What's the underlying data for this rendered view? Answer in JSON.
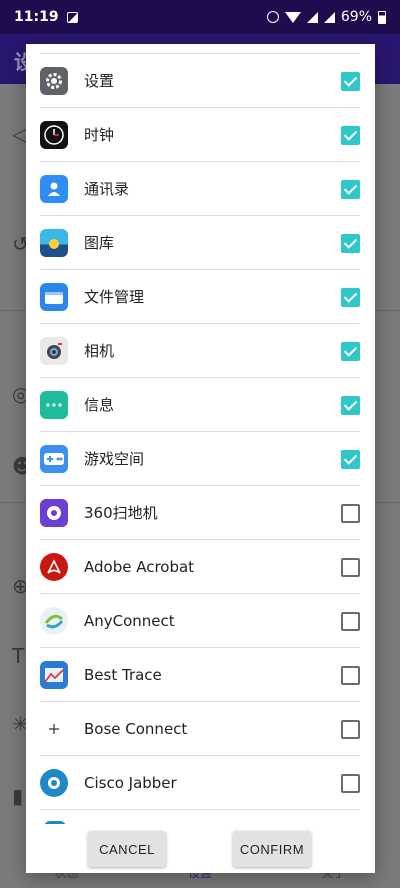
{
  "status_bar": {
    "time": "11:19",
    "battery": "69%"
  },
  "app_bar": {
    "title_fragment": "设"
  },
  "background_nav": {
    "items": [
      "状态",
      "设置",
      "关于"
    ]
  },
  "dialog": {
    "apps": [
      {
        "label": "设置",
        "icon": "settings-gear-icon",
        "checked": true,
        "color": "#5f6368"
      },
      {
        "label": "时钟",
        "icon": "clock-icon",
        "checked": true,
        "color": "#111111"
      },
      {
        "label": "通讯录",
        "icon": "contacts-icon",
        "checked": true,
        "color": "#2f8ef3"
      },
      {
        "label": "图库",
        "icon": "gallery-icon",
        "checked": true,
        "color": "#1d4f8c"
      },
      {
        "label": "文件管理",
        "icon": "file-manager-icon",
        "checked": true,
        "color": "#2a86e8"
      },
      {
        "label": "相机",
        "icon": "camera-icon",
        "checked": true,
        "color": "#e9e9e9"
      },
      {
        "label": "信息",
        "icon": "messages-icon",
        "checked": true,
        "color": "#1fbc9c"
      },
      {
        "label": "游戏空间",
        "icon": "game-space-icon",
        "checked": true,
        "color": "#3d8ff0"
      },
      {
        "label": "360扫地机",
        "icon": "robot-vacuum-icon",
        "checked": false,
        "color": "#6a3fd1"
      },
      {
        "label": "Adobe Acrobat",
        "icon": "adobe-acrobat-icon",
        "checked": false,
        "color": "#c8180f"
      },
      {
        "label": "AnyConnect",
        "icon": "anyconnect-icon",
        "checked": false,
        "color": "#3aa0c8"
      },
      {
        "label": "Best Trace",
        "icon": "best-trace-icon",
        "checked": false,
        "color": "#2a7bd6"
      },
      {
        "label": "Bose Connect",
        "icon": "bose-connect-icon",
        "checked": false,
        "color": "#333333"
      },
      {
        "label": "Cisco Jabber",
        "icon": "cisco-jabber-icon",
        "checked": false,
        "color": "#1e88c9"
      }
    ],
    "cancel_label": "CANCEL",
    "confirm_label": "CONFIRM"
  }
}
